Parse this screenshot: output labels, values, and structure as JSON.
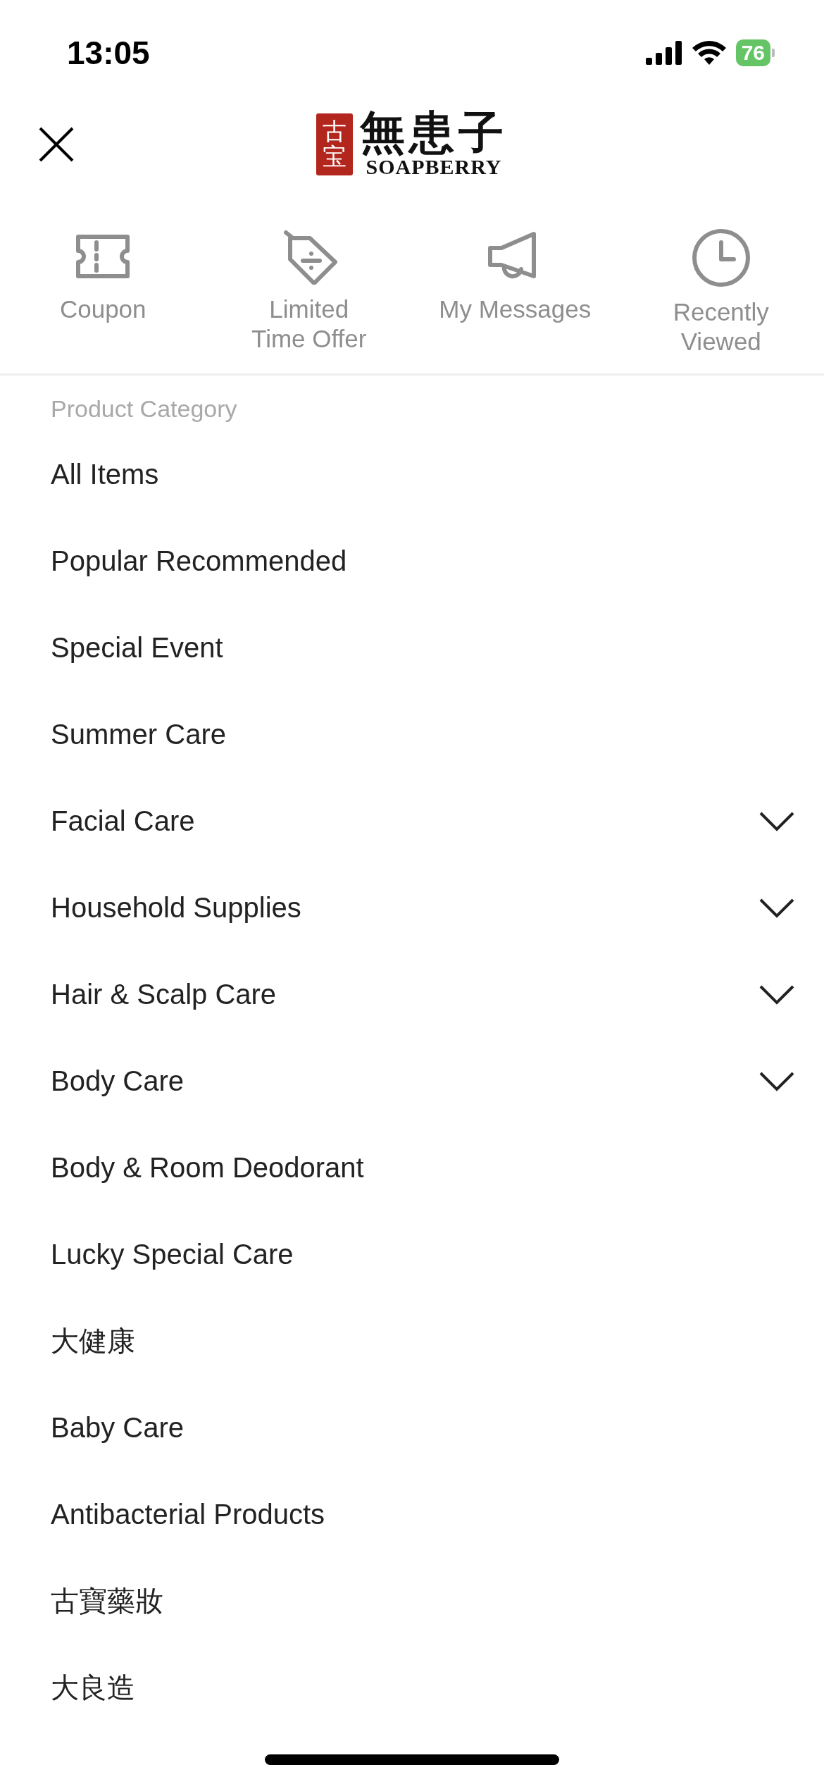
{
  "status_bar": {
    "time": "13:05",
    "battery": "76"
  },
  "header": {
    "logo": {
      "seal": "古宝",
      "name": "無患子",
      "brand": "SOAPBERRY"
    }
  },
  "shortcuts": [
    {
      "kind": "coupon",
      "label": "Coupon"
    },
    {
      "kind": "tag",
      "label": "Limited\nTime Offer"
    },
    {
      "kind": "megaphone",
      "label": "My Messages"
    },
    {
      "kind": "clock",
      "label": "Recently\nViewed"
    }
  ],
  "category_heading": "Product Category",
  "categories": [
    {
      "label": "All Items",
      "expandable": false
    },
    {
      "label": "Popular Recommended",
      "expandable": false
    },
    {
      "label": "Special Event",
      "expandable": false
    },
    {
      "label": "Summer Care",
      "expandable": false
    },
    {
      "label": "Facial Care",
      "expandable": true
    },
    {
      "label": "Household Supplies",
      "expandable": true
    },
    {
      "label": "Hair & Scalp Care",
      "expandable": true
    },
    {
      "label": "Body Care",
      "expandable": true
    },
    {
      "label": "Body & Room Deodorant",
      "expandable": false
    },
    {
      "label": "Lucky Special Care",
      "expandable": false
    },
    {
      "label": "大健康",
      "expandable": false
    },
    {
      "label": "Baby Care",
      "expandable": false
    },
    {
      "label": "Antibacterial Products",
      "expandable": false
    },
    {
      "label": "古寶藥妝",
      "expandable": false
    },
    {
      "label": "大良造",
      "expandable": false
    }
  ]
}
